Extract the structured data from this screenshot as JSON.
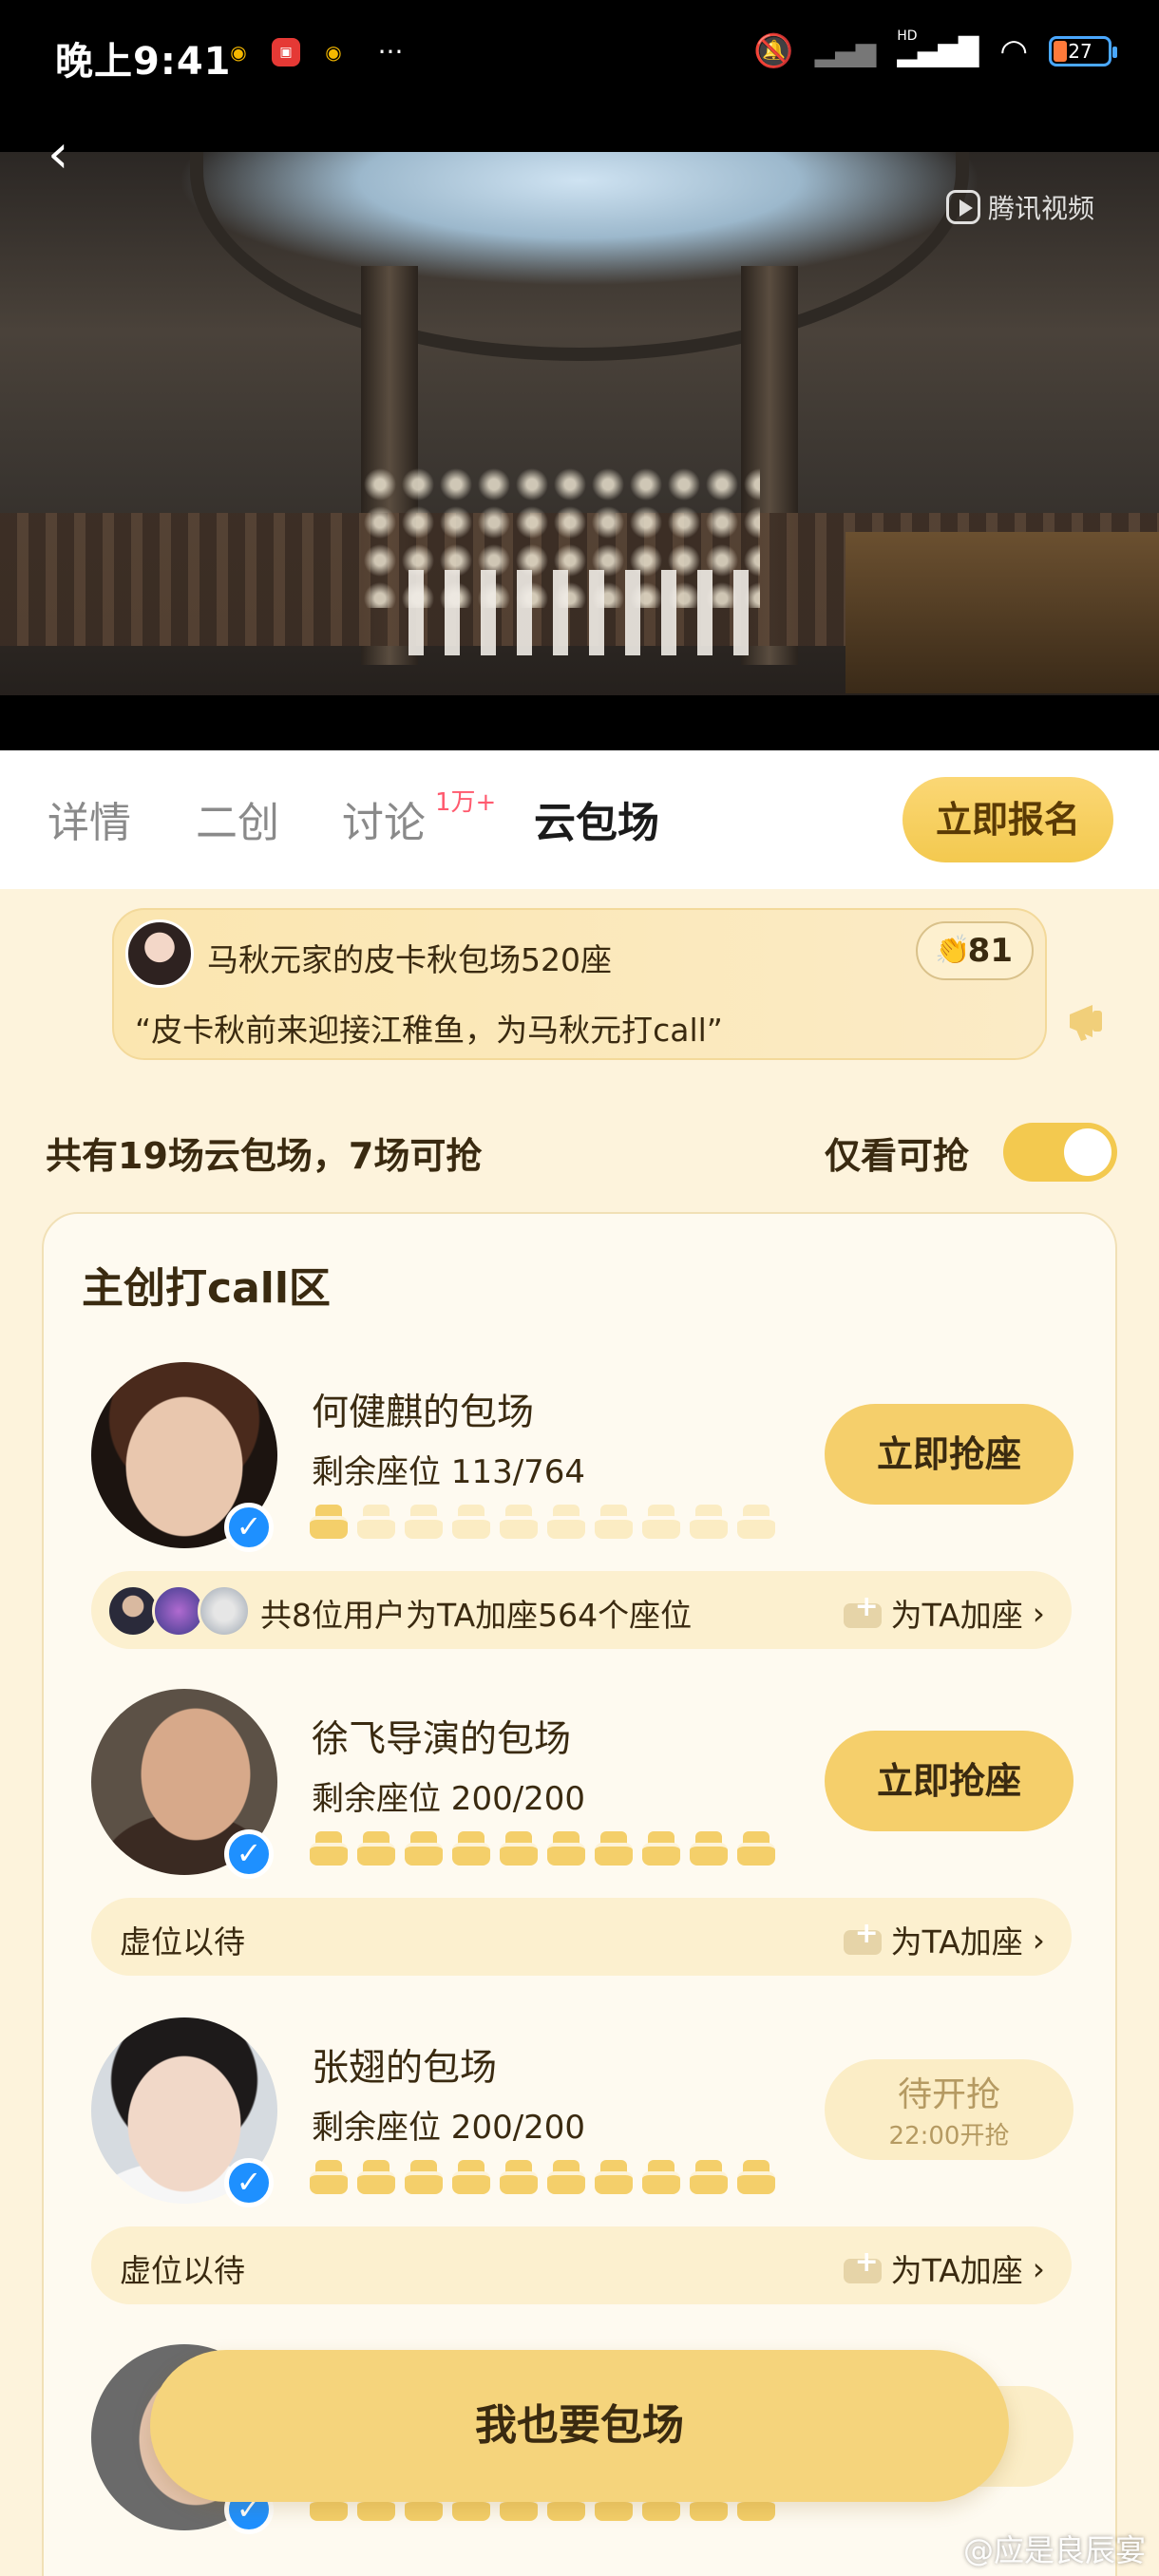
{
  "status_bar": {
    "time": "晚上9:41",
    "more": "···",
    "battery": "27",
    "hd": "HD"
  },
  "video": {
    "watermark": "腾讯视频"
  },
  "tabs": [
    {
      "label": "详情"
    },
    {
      "label": "二创"
    },
    {
      "label": "讨论"
    },
    {
      "label": "云包场"
    }
  ],
  "tab_badge": "1万+",
  "signup_label": "立即报名",
  "banner": {
    "title": "马秋元家的皮卡秋包场520座",
    "quote": "“皮卡秋前来迎接江稚鱼，为马秋元打call”",
    "likes": "81"
  },
  "summary": "共有19场云包场，7场可抢",
  "only_available_label": "仅看可抢",
  "only_available_on": true,
  "section_title": "主创打call区",
  "entries": [
    {
      "name": "何健麒的包场",
      "seats": "剩余座位 113/764",
      "filled": 1.5,
      "button": "立即抢座",
      "sub_text": "共8位用户为TA加座564个座位",
      "add_label": "为TA加座"
    },
    {
      "name": "徐飞导演的包场",
      "seats": "剩余座位 200/200",
      "filled": 10,
      "button": "立即抢座",
      "sub_text": "虚位以待",
      "add_label": "为TA加座"
    },
    {
      "name": "张翅的包场",
      "seats": "剩余座位 200/200",
      "filled": 10,
      "button_main": "待开抢",
      "button_sub": "22:00开抢",
      "sub_text": "虚位以待",
      "add_label": "为TA加座"
    }
  ],
  "fab_label": "我也要包场",
  "watermark": "@应是良辰宴",
  "colors": {
    "accent": "#f5cf6b",
    "page_bg": "#fdf3dc",
    "verified": "#1e90ff"
  }
}
